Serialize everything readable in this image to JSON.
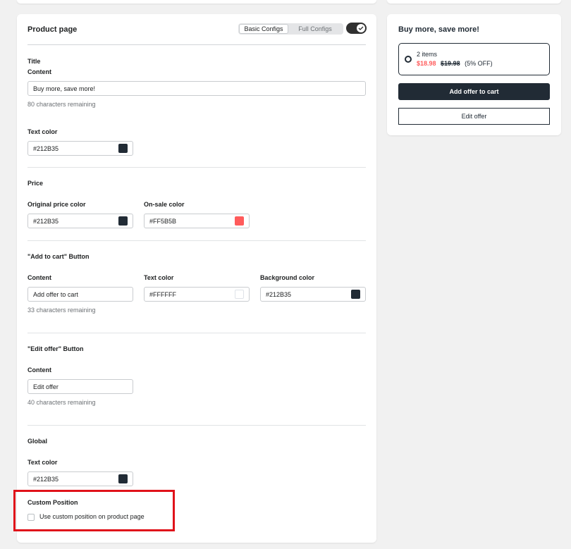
{
  "settings": {
    "card_title": "Product page",
    "mode_tabs": [
      {
        "label": "Basic Configs",
        "selected": true
      },
      {
        "label": "Full Configs",
        "selected": false
      }
    ],
    "toggle_on": true,
    "title_section": {
      "heading": "Title",
      "content_label": "Content",
      "content_value": "Buy more, save more!",
      "content_help": "80 characters remaining",
      "text_color_label": "Text color",
      "text_color_value": "#212B35"
    },
    "price_section": {
      "heading": "Price",
      "original_label": "Original price color",
      "original_value": "#212B35",
      "onsale_label": "On-sale color",
      "onsale_value": "#FF5B5B"
    },
    "add_to_cart_section": {
      "heading": "\"Add to cart\" Button",
      "content_label": "Content",
      "content_value": "Add offer to cart",
      "content_help": "33 characters remaining",
      "text_color_label": "Text color",
      "text_color_value": "#FFFFFF",
      "bg_color_label": "Background color",
      "bg_color_value": "#212B35"
    },
    "edit_offer_section": {
      "heading": "\"Edit offer\" Button",
      "content_label": "Content",
      "content_value": "Edit offer",
      "content_help": "40 characters remaining"
    },
    "global_section": {
      "heading": "Global",
      "text_color_label": "Text color",
      "text_color_value": "#212B35"
    },
    "custom_position": {
      "heading": "Custom Position",
      "checkbox_label": "Use custom position on product page",
      "checked": false
    }
  },
  "preview": {
    "title": "Buy more, save more!",
    "offer": {
      "items": "2 items",
      "sale_price": "$18.98",
      "original_price": "$19.98",
      "discount": "(5% OFF)"
    },
    "add_button_label": "Add offer to cart",
    "edit_button_label": "Edit offer"
  },
  "colors": {
    "dark": "#212B35",
    "sale": "#FF5B5B",
    "white": "#FFFFFF",
    "highlight": "#E0121A"
  }
}
